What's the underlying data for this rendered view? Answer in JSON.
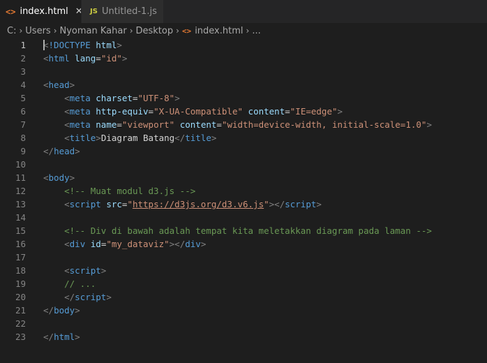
{
  "tabs": [
    {
      "icon": "<>",
      "label": "index.html",
      "close": "✕",
      "active": true
    },
    {
      "icon": "JS",
      "label": "Untitled-1.js",
      "active": false
    }
  ],
  "breadcrumb": [
    "C:",
    "Users",
    "Nyoman Kahar",
    "Desktop",
    "index.html",
    "..."
  ],
  "breadcrumb_sep": "›",
  "editor": {
    "active_line": 1,
    "lines": [
      {
        "n": "1",
        "tokens": [
          {
            "c": "punct",
            "t": "<"
          },
          {
            "c": "tag",
            "t": "!DOCTYPE"
          },
          {
            "c": "text",
            "t": " "
          },
          {
            "c": "attr",
            "t": "html"
          },
          {
            "c": "punct",
            "t": ">"
          }
        ]
      },
      {
        "n": "2",
        "tokens": [
          {
            "c": "punct",
            "t": "<"
          },
          {
            "c": "tag",
            "t": "html"
          },
          {
            "c": "text",
            "t": " "
          },
          {
            "c": "attr",
            "t": "lang"
          },
          {
            "c": "text",
            "t": "="
          },
          {
            "c": "str",
            "t": "\"id\""
          },
          {
            "c": "punct",
            "t": ">"
          }
        ]
      },
      {
        "n": "3",
        "tokens": []
      },
      {
        "n": "4",
        "tokens": [
          {
            "c": "punct",
            "t": "<"
          },
          {
            "c": "tag",
            "t": "head"
          },
          {
            "c": "punct",
            "t": ">"
          }
        ]
      },
      {
        "n": "5",
        "tokens": [
          {
            "c": "text",
            "t": "    "
          },
          {
            "c": "punct",
            "t": "<"
          },
          {
            "c": "tag",
            "t": "meta"
          },
          {
            "c": "text",
            "t": " "
          },
          {
            "c": "attr",
            "t": "charset"
          },
          {
            "c": "text",
            "t": "="
          },
          {
            "c": "str",
            "t": "\"UTF-8\""
          },
          {
            "c": "punct",
            "t": ">"
          }
        ]
      },
      {
        "n": "6",
        "tokens": [
          {
            "c": "text",
            "t": "    "
          },
          {
            "c": "punct",
            "t": "<"
          },
          {
            "c": "tag",
            "t": "meta"
          },
          {
            "c": "text",
            "t": " "
          },
          {
            "c": "attr",
            "t": "http-equiv"
          },
          {
            "c": "text",
            "t": "="
          },
          {
            "c": "str",
            "t": "\"X-UA-Compatible\""
          },
          {
            "c": "text",
            "t": " "
          },
          {
            "c": "attr",
            "t": "content"
          },
          {
            "c": "text",
            "t": "="
          },
          {
            "c": "str",
            "t": "\"IE=edge\""
          },
          {
            "c": "punct",
            "t": ">"
          }
        ]
      },
      {
        "n": "7",
        "tokens": [
          {
            "c": "text",
            "t": "    "
          },
          {
            "c": "punct",
            "t": "<"
          },
          {
            "c": "tag",
            "t": "meta"
          },
          {
            "c": "text",
            "t": " "
          },
          {
            "c": "attr",
            "t": "name"
          },
          {
            "c": "text",
            "t": "="
          },
          {
            "c": "str",
            "t": "\"viewport\""
          },
          {
            "c": "text",
            "t": " "
          },
          {
            "c": "attr",
            "t": "content"
          },
          {
            "c": "text",
            "t": "="
          },
          {
            "c": "str",
            "t": "\"width=device-width, initial-scale=1.0\""
          },
          {
            "c": "punct",
            "t": ">"
          }
        ]
      },
      {
        "n": "8",
        "tokens": [
          {
            "c": "text",
            "t": "    "
          },
          {
            "c": "punct",
            "t": "<"
          },
          {
            "c": "tag",
            "t": "title"
          },
          {
            "c": "punct",
            "t": ">"
          },
          {
            "c": "text",
            "t": "Diagram Batang"
          },
          {
            "c": "punct",
            "t": "</"
          },
          {
            "c": "tag",
            "t": "title"
          },
          {
            "c": "punct",
            "t": ">"
          }
        ]
      },
      {
        "n": "9",
        "tokens": [
          {
            "c": "punct",
            "t": "</"
          },
          {
            "c": "tag",
            "t": "head"
          },
          {
            "c": "punct",
            "t": ">"
          }
        ]
      },
      {
        "n": "10",
        "tokens": []
      },
      {
        "n": "11",
        "tokens": [
          {
            "c": "punct",
            "t": "<"
          },
          {
            "c": "tag",
            "t": "body"
          },
          {
            "c": "punct",
            "t": ">"
          }
        ]
      },
      {
        "n": "12",
        "tokens": [
          {
            "c": "text",
            "t": "    "
          },
          {
            "c": "comment",
            "t": "<!-- Muat modul d3.js -->"
          }
        ]
      },
      {
        "n": "13",
        "tokens": [
          {
            "c": "text",
            "t": "    "
          },
          {
            "c": "punct",
            "t": "<"
          },
          {
            "c": "tag",
            "t": "script"
          },
          {
            "c": "text",
            "t": " "
          },
          {
            "c": "attr",
            "t": "src"
          },
          {
            "c": "text",
            "t": "="
          },
          {
            "c": "str",
            "t": "\""
          },
          {
            "c": "link",
            "t": "https://d3js.org/d3.v6.js"
          },
          {
            "c": "str",
            "t": "\""
          },
          {
            "c": "punct",
            "t": "></"
          },
          {
            "c": "tag",
            "t": "script"
          },
          {
            "c": "punct",
            "t": ">"
          }
        ]
      },
      {
        "n": "14",
        "tokens": []
      },
      {
        "n": "15",
        "tokens": [
          {
            "c": "text",
            "t": "    "
          },
          {
            "c": "comment",
            "t": "<!-- Div di bawah adalah tempat kita meletakkan diagram pada laman -->"
          }
        ]
      },
      {
        "n": "16",
        "tokens": [
          {
            "c": "text",
            "t": "    "
          },
          {
            "c": "punct",
            "t": "<"
          },
          {
            "c": "tag",
            "t": "div"
          },
          {
            "c": "text",
            "t": " "
          },
          {
            "c": "attr",
            "t": "id"
          },
          {
            "c": "text",
            "t": "="
          },
          {
            "c": "str",
            "t": "\"my_dataviz\""
          },
          {
            "c": "punct",
            "t": "></"
          },
          {
            "c": "tag",
            "t": "div"
          },
          {
            "c": "punct",
            "t": ">"
          }
        ]
      },
      {
        "n": "17",
        "tokens": []
      },
      {
        "n": "18",
        "tokens": [
          {
            "c": "text",
            "t": "    "
          },
          {
            "c": "punct",
            "t": "<"
          },
          {
            "c": "tag",
            "t": "script"
          },
          {
            "c": "punct",
            "t": ">"
          }
        ]
      },
      {
        "n": "19",
        "tokens": [
          {
            "c": "text",
            "t": "    "
          },
          {
            "c": "comment",
            "t": "// ..."
          }
        ]
      },
      {
        "n": "20",
        "tokens": [
          {
            "c": "text",
            "t": "    "
          },
          {
            "c": "punct",
            "t": "</"
          },
          {
            "c": "tag",
            "t": "script"
          },
          {
            "c": "punct",
            "t": ">"
          }
        ]
      },
      {
        "n": "21",
        "tokens": [
          {
            "c": "punct",
            "t": "</"
          },
          {
            "c": "tag",
            "t": "body"
          },
          {
            "c": "punct",
            "t": ">"
          }
        ]
      },
      {
        "n": "22",
        "tokens": []
      },
      {
        "n": "23",
        "tokens": [
          {
            "c": "punct",
            "t": "</"
          },
          {
            "c": "tag",
            "t": "html"
          },
          {
            "c": "punct",
            "t": ">"
          }
        ]
      }
    ]
  },
  "colors": {
    "background": "#1e1e1e",
    "tab_bar": "#252526",
    "tag": "#569cd6",
    "attribute": "#9cdcfe",
    "string": "#ce9178",
    "comment": "#6a9955",
    "punctuation": "#808080",
    "text": "#d4d4d4",
    "line_number": "#858585"
  }
}
